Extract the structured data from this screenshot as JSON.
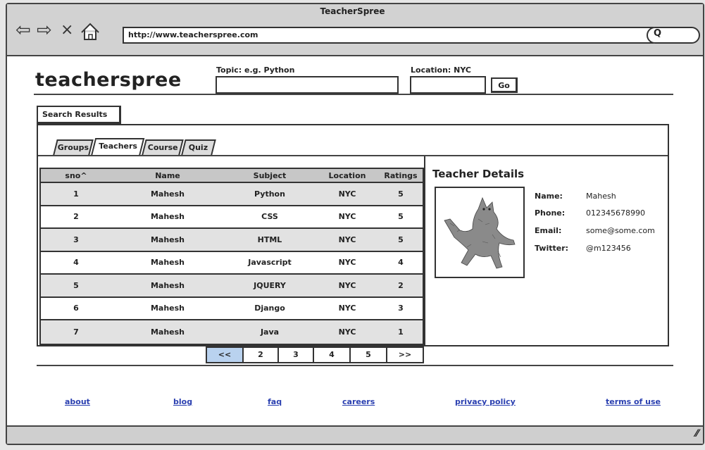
{
  "window": {
    "title": "TeacherSpree",
    "url": "http://www.teacherspree.com",
    "search_glyph": "Q"
  },
  "header": {
    "logo": "teacherspree",
    "topic_label": "Topic: e.g. Python",
    "topic_value": "",
    "location_label": "Location: NYC",
    "location_value": "",
    "go_label": "Go"
  },
  "results_button": "Search Results",
  "tabs": [
    {
      "label": "Groups",
      "active": false
    },
    {
      "label": "Teachers",
      "active": true
    },
    {
      "label": "Course",
      "active": false
    },
    {
      "label": "Quiz",
      "active": false
    }
  ],
  "table": {
    "columns": [
      "sno^",
      "Name",
      "Subject",
      "Location",
      "Ratings"
    ],
    "rows": [
      [
        "1",
        "Mahesh",
        "Python",
        "NYC",
        "5"
      ],
      [
        "2",
        "Mahesh",
        "CSS",
        "NYC",
        "5"
      ],
      [
        "3",
        "Mahesh",
        "HTML",
        "NYC",
        "5"
      ],
      [
        "4",
        "Mahesh",
        "Javascript",
        "NYC",
        "4"
      ],
      [
        "5",
        "Mahesh",
        "JQUERY",
        "NYC",
        "2"
      ],
      [
        "6",
        "Mahesh",
        "Django",
        "NYC",
        "3"
      ],
      [
        "7",
        "Mahesh",
        "Java",
        "NYC",
        "1"
      ]
    ]
  },
  "pagination": [
    "<<",
    "2",
    "3",
    "4",
    "5",
    ">>"
  ],
  "details": {
    "title": "Teacher Details",
    "fields": [
      {
        "label": "Name:",
        "value": "Mahesh"
      },
      {
        "label": "Phone:",
        "value": "012345678990"
      },
      {
        "label": "Email:",
        "value": "some@some.com"
      },
      {
        "label": "Twitter:",
        "value": "@m123456"
      }
    ]
  },
  "footer": [
    "about",
    "blog",
    "faq",
    "careers",
    "privacy policy",
    "terms of use"
  ],
  "colors": {
    "active_page": "#b9d2ef",
    "link": "#2a3fb0",
    "chrome": "#d2d2d2"
  }
}
